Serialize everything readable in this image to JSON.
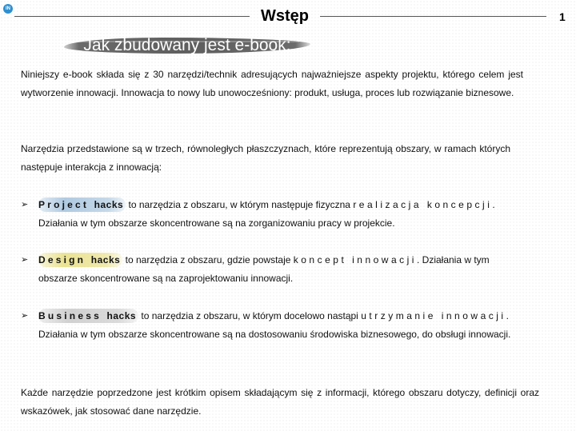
{
  "header": {
    "logo_text": "IN",
    "title": "Wstęp",
    "page_number": "1"
  },
  "section_heading": "Jak zbudowany jest e-book:",
  "intro_paragraph": "Niniejszy e-book składa się z 30 narzędzi/technik adresujących najważniejsze aspekty projektu, którego celem jest wytworzenie innowacji. Innowacja to nowy lub unowocześniony: produkt, usługa, proces lub rozwiązanie biznesowe.",
  "tools_paragraph": "Narzędzia przedstawione są w trzech, równoległych płaszczyznach, które reprezentują obszary, w ramach których następuje interakcja z innowacją:",
  "bullet_symbol": "➢",
  "bullets": [
    {
      "name": "Project",
      "suffix": "hacks",
      "text_before": " to narzędzia z obszaru, w którym następuje fizyczna ",
      "spaced": "realizacja koncepcji",
      "text_after": ". Działania w tym obszarze skoncentrowane są na zorganizowaniu pracy w projekcie.",
      "highlight_color": "#96b9d7"
    },
    {
      "name": "Design",
      "suffix": "hacks",
      "text_before": " to narzędzia z obszaru, gdzie powstaje ",
      "spaced": "koncept innowacji",
      "text_after": ". Działania w tym obszarze skoncentrowane są na zaprojektowaniu innowacji.",
      "highlight_color": "#e6dc78"
    },
    {
      "name": "Business",
      "suffix": "hacks",
      "text_before": " to narzędzia z obszaru, w którym docelowo nastąpi ",
      "spaced": "utrzymanie innowacji",
      "text_after": ". Działania w tym obszarze skoncentrowane są na dostosowaniu środowiska biznesowego, do obsługi innowacji.",
      "highlight_color": "#bebebe"
    }
  ],
  "closing_paragraph": "Każde narzędzie poprzedzone jest krótkim opisem składającym się z informacji, którego obszaru dotyczy, definicji oraz wskazówek, jak stosować dane narzędzie."
}
